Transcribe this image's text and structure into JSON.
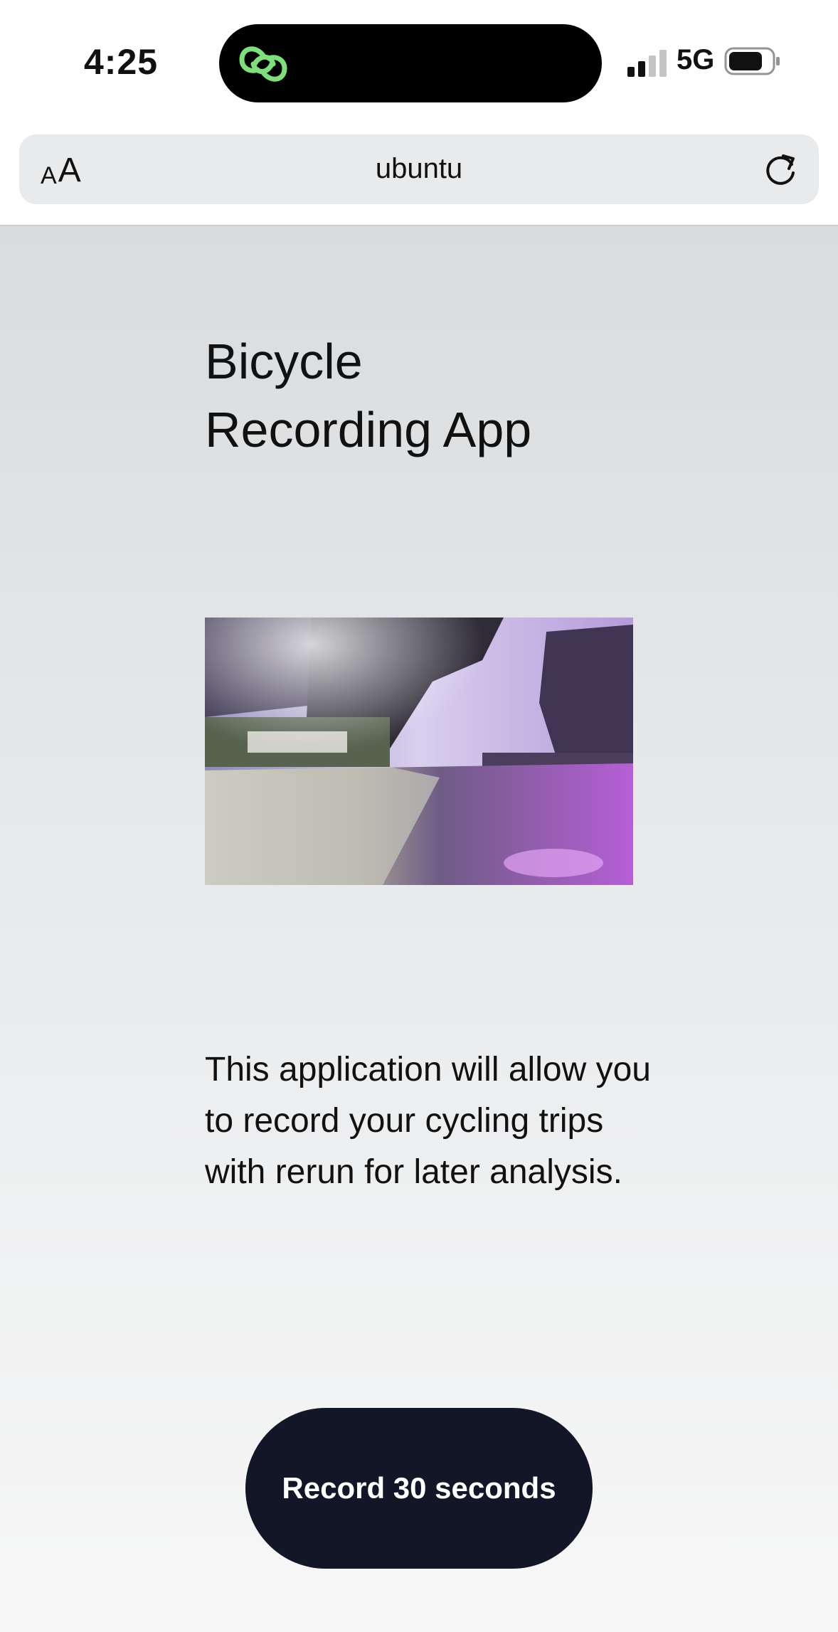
{
  "status_bar": {
    "time": "4:25",
    "network": "5G",
    "island_app_icon": "link-icon",
    "accent": "#7ee07b"
  },
  "browser": {
    "text_size_small": "A",
    "text_size_big": "A",
    "url": "ubuntu"
  },
  "page": {
    "title_line1": "Bicycle",
    "title_line2": "Recording App",
    "hero_image": "cycling-road-photo",
    "description": "This application will allow you to record your cycling trips with rerun for later analysis.",
    "record_button_label": "Record 30 seconds",
    "button_color": "#121627"
  }
}
